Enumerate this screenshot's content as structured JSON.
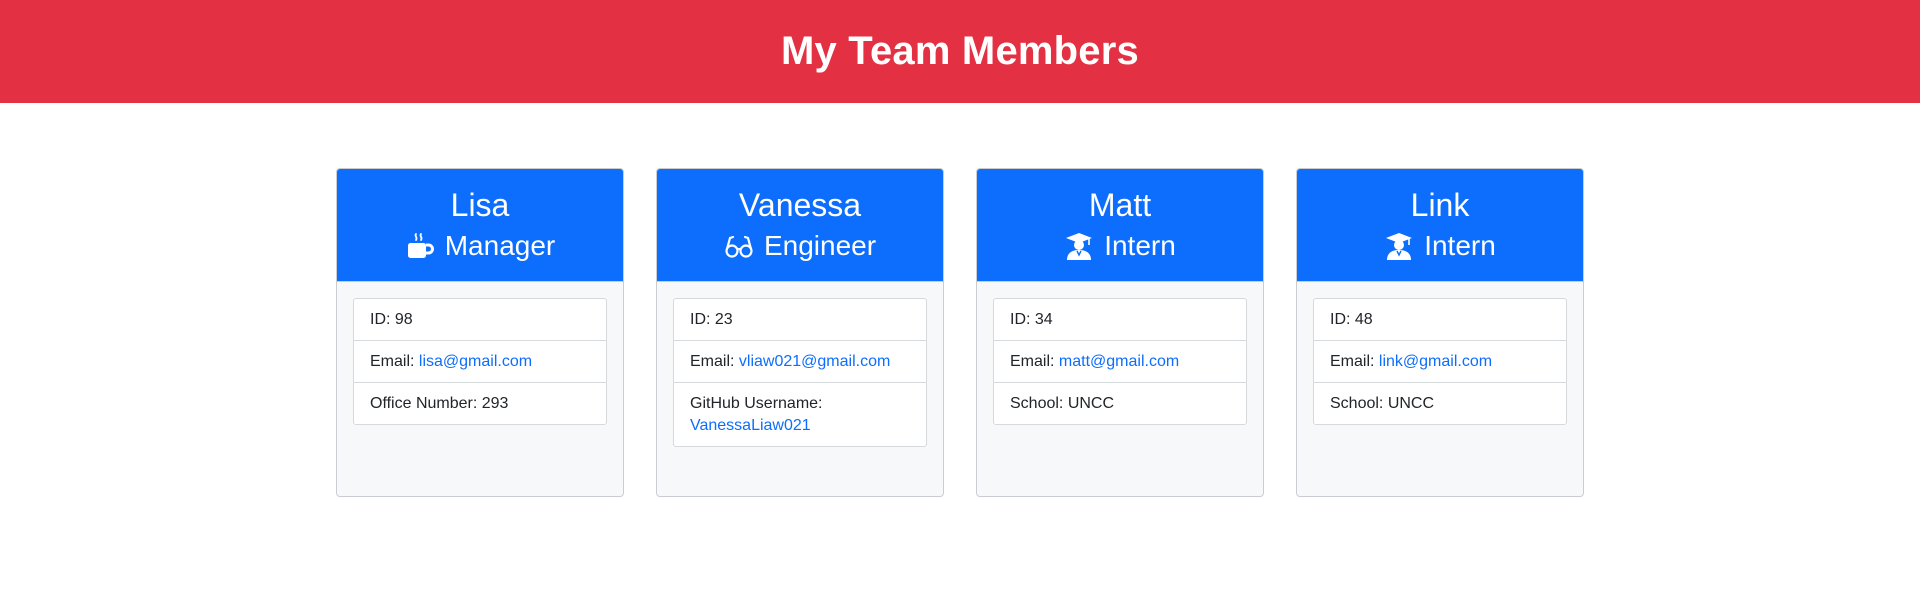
{
  "header": {
    "title": "My Team Members",
    "background": "#e33042"
  },
  "accent": "#0d6efd",
  "cards": [
    {
      "name": "Lisa",
      "role": "Manager",
      "icon": "coffee-mug-icon",
      "id_text": "ID: 98",
      "email_label": "Email: ",
      "email": "lisa@gmail.com",
      "extra_label": "Office Number: 293"
    },
    {
      "name": "Vanessa",
      "role": "Engineer",
      "icon": "glasses-icon",
      "id_text": "ID: 23",
      "email_label": "Email: ",
      "email": "vliaw021@gmail.com",
      "extra_label": "GitHub Username:",
      "github": "VanessaLiaw021"
    },
    {
      "name": "Matt",
      "role": "Intern",
      "icon": "graduate-icon",
      "id_text": "ID: 34",
      "email_label": "Email: ",
      "email": "matt@gmail.com",
      "extra_label": "School: UNCC"
    },
    {
      "name": "Link",
      "role": "Intern",
      "icon": "graduate-icon",
      "id_text": "ID: 48",
      "email_label": "Email: ",
      "email": "link@gmail.com",
      "extra_label": "School: UNCC"
    }
  ]
}
